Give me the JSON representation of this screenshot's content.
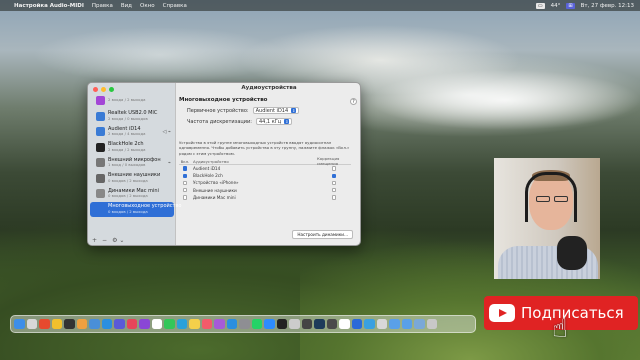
{
  "menubar": {
    "apple": "",
    "app_name": "Настройка Audio-MIDI",
    "menus": [
      "Правка",
      "Вид",
      "Окно",
      "Справка"
    ],
    "status": [
      "44°",
      "Вт, 27 февр. 12:13"
    ],
    "status_icon": "control-center-icon"
  },
  "window": {
    "title": "Аудиоустройства",
    "devices": [
      {
        "name": "",
        "sub": "2 входа / 2 выхода",
        "icon": "usb-icon",
        "color": "#a346d6"
      },
      {
        "name": "Realtek USB2.0 MIC",
        "sub": "2 входа / 0 выходов",
        "icon": "usb-icon",
        "color": "#3a7bd5"
      },
      {
        "name": "Audient iD14",
        "sub": "2 входа / 4 выхода",
        "icon": "usb-icon",
        "color": "#3a7bd5",
        "extra": "◁ ⌁"
      },
      {
        "name": "BlackHole 2ch",
        "sub": "2 входа / 2 выхода",
        "icon": "blackhole-icon",
        "color": "#222222"
      },
      {
        "name": "Внешний микрофон",
        "sub": "1 вход / 0 выходов",
        "icon": "microphone-icon",
        "color": "#777777",
        "extra": "⌁"
      },
      {
        "name": "Внешние наушники",
        "sub": "0 входов / 2 выхода",
        "icon": "headphones-icon",
        "color": "#666666"
      },
      {
        "name": "Динамики Mac mini",
        "sub": "0 входов / 2 выхода",
        "icon": "speaker-icon",
        "color": "#888888"
      },
      {
        "name": "Многовыходное устройство",
        "sub": "0 входов / 2 выхода",
        "icon": "multi-output-icon",
        "color": "#2f6fd6",
        "selected": true
      }
    ],
    "bottom_controls": [
      "+",
      "−",
      "⚙ ⌄"
    ],
    "header": "Многовыходное устройство",
    "primary_label": "Первичное устройство:",
    "primary_value": "Audient iD14",
    "rate_label": "Частота дискретизации:",
    "rate_value": "44,1 кГц",
    "help": "?",
    "description": "Устройства в этой группе многовыходных устройств вводят аудиосигнал одновременно. Чтобы добавить устройство в эту группу, нажмите флажок «Вкл.» рядом с этим устройством.",
    "table": {
      "headers": [
        "Вкл.",
        "Аудиоустройство",
        "Коррекция смещения"
      ],
      "rows": [
        {
          "name": "Audient iD14",
          "on": true,
          "drift": false
        },
        {
          "name": "BlackHole 2ch",
          "on": true,
          "drift": true
        },
        {
          "name": "Устройство «iPhone»",
          "on": false,
          "drift": false
        },
        {
          "name": "Внешние наушники",
          "on": false,
          "drift": false
        },
        {
          "name": "Динамики Mac mini",
          "on": false,
          "drift": false
        }
      ]
    },
    "configure_button": "Настроить динамики..."
  },
  "subscribe": {
    "label": "Подписаться"
  },
  "dock": {
    "icons": [
      {
        "name": "finder-icon",
        "color": "#3d8ee8"
      },
      {
        "name": "launchpad-icon",
        "color": "#d8d8d8"
      },
      {
        "name": "yandex-browser-icon",
        "color": "#e64a2e"
      },
      {
        "name": "chrome-icon",
        "color": "#f0c02c"
      },
      {
        "name": "screenflow-icon",
        "color": "#333333"
      },
      {
        "name": "photos-icon",
        "color": "#f0a040"
      },
      {
        "name": "files-icon",
        "color": "#4a8fd8"
      },
      {
        "name": "safari-icon",
        "color": "#2a8fe0"
      },
      {
        "name": "app-icon",
        "color": "#5a5ad8"
      },
      {
        "name": "music-icon",
        "color": "#e6455a"
      },
      {
        "name": "app2-icon",
        "color": "#8a46d6"
      },
      {
        "name": "calendar-icon",
        "color": "#ffffff"
      },
      {
        "name": "messages-icon",
        "color": "#34c759"
      },
      {
        "name": "telegram-icon",
        "color": "#2aa1da"
      },
      {
        "name": "notes-icon",
        "color": "#f5d04a"
      },
      {
        "name": "music2-icon",
        "color": "#f55a6a"
      },
      {
        "name": "podcasts-icon",
        "color": "#a65ad8"
      },
      {
        "name": "app-store-icon",
        "color": "#2a8fe0"
      },
      {
        "name": "settings-icon",
        "color": "#8e8e93"
      },
      {
        "name": "whatsapp-icon",
        "color": "#25d366"
      },
      {
        "name": "zoom-icon",
        "color": "#2d8cff"
      },
      {
        "name": "terminal-icon",
        "color": "#222222"
      },
      {
        "name": "audio-icon",
        "color": "#cccccc"
      },
      {
        "name": "activity-icon",
        "color": "#444444"
      },
      {
        "name": "photoshop-icon",
        "color": "#1d3b5a"
      },
      {
        "name": "app3-icon",
        "color": "#4a4a4a"
      },
      {
        "name": "app4-icon",
        "color": "#ffffff"
      },
      {
        "name": "app5-icon",
        "color": "#2a6ad8"
      },
      {
        "name": "id-icon",
        "color": "#3aa0e0"
      },
      {
        "name": "app6-icon",
        "color": "#d8d8d8"
      },
      {
        "name": "folder-icon",
        "color": "#5aa0e8"
      },
      {
        "name": "folder2-icon",
        "color": "#5aa0e8"
      },
      {
        "name": "folder3-icon",
        "color": "#7aa8d8"
      },
      {
        "name": "trash-icon",
        "color": "#c8c8c8"
      }
    ]
  }
}
